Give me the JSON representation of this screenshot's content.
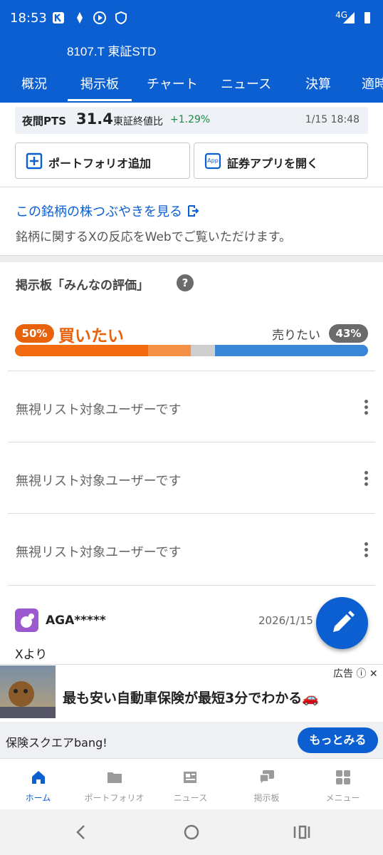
{
  "status": {
    "time": "18:53",
    "network": "4G"
  },
  "header": {
    "ticker": "8107.T 東証STD"
  },
  "tabs": [
    {
      "label": "概況"
    },
    {
      "label": "掲示板",
      "active": true
    },
    {
      "label": "チャート"
    },
    {
      "label": "ニュース"
    },
    {
      "label": "決算"
    },
    {
      "label": "適時"
    }
  ],
  "pts": {
    "label": "夜間PTS",
    "value": "31.4",
    "compare_label": "東証終値比",
    "change": "+1.29%",
    "datetime": "1/15 18:48"
  },
  "buttons": {
    "portfolio": "ポートフォリオ追加",
    "app": "証券アプリを開く"
  },
  "xsection": {
    "link": "この銘柄の株つぶやきを見る",
    "sub": "銘柄に関するXの反応をWebでご覧いただけます。"
  },
  "evaluation": {
    "title": "掲示板「みんなの評価」",
    "buy_pct": "50%",
    "buy_label": "買いたい",
    "sell_pct": "43%",
    "sell_label": "売りたい",
    "bar": [
      {
        "fraction": 0.378,
        "color": "#f26b10"
      },
      {
        "fraction": 0.12,
        "color": "#f59147"
      },
      {
        "fraction": 0.068,
        "color": "#cfcfcf"
      },
      {
        "fraction": 0.434,
        "color": "#3a86d6"
      }
    ]
  },
  "posts": [
    {
      "text": "無視リスト対象ユーザーです"
    },
    {
      "text": "無視リスト対象ユーザーです"
    },
    {
      "text": "無視リスト対象ユーザーです"
    }
  ],
  "post": {
    "user": "AGA*****",
    "date": "2026/1/15 1",
    "text": "Xより"
  },
  "ad": {
    "badge": "広告",
    "title": "最も安い自動車保険が最短3分でわかる🚗",
    "source": "保険スクエアbang!",
    "more": "もっとみる"
  },
  "bottom_nav": [
    {
      "label": "ホーム",
      "icon": "home-icon",
      "active": true
    },
    {
      "label": "ポートフォリオ",
      "icon": "folder-icon"
    },
    {
      "label": "ニュース",
      "icon": "news-icon"
    },
    {
      "label": "掲示板",
      "icon": "chat-icon"
    },
    {
      "label": "メニュー",
      "icon": "grid-menu-icon"
    }
  ]
}
